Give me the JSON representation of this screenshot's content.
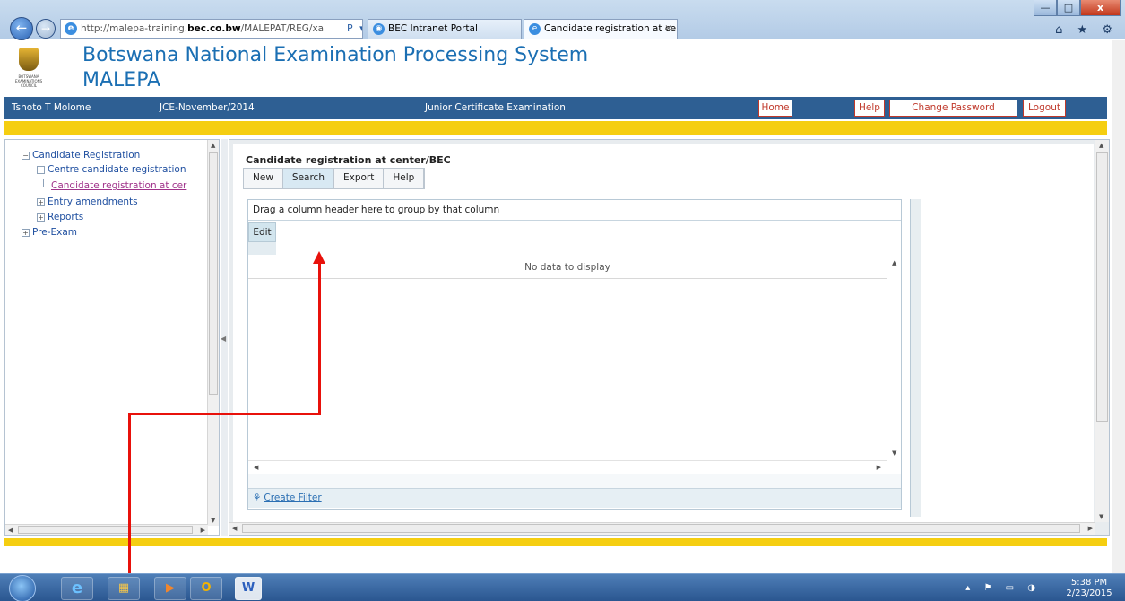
{
  "browser": {
    "url_prefix": "http://malepa-training.",
    "url_host": "bec.co.bw",
    "url_path": "/MALEPAT/REG/xa",
    "address_tools": "Ρ ▾ ☷ C ✕",
    "tabs": [
      {
        "label": "BEC Intranet Portal"
      },
      {
        "label": "Candidate registration at ce...",
        "close": "✕"
      }
    ],
    "window_controls": {
      "minimize": "—",
      "maximize": "□",
      "close": "x"
    },
    "toolbar_icons": "⌂ ★ ⚙"
  },
  "header": {
    "logo_text": "BOTSWANA EXAMINATIONS COUNCIL",
    "title": "Botswana National Examination Processing System",
    "subtitle": "MALEPA"
  },
  "navbar": {
    "user": "Tshoto T Molome",
    "session": "JCE-November/2014",
    "exam": "Junior Certificate Examination",
    "links": {
      "home": "Home",
      "help": "Help",
      "change_password": "Change Password",
      "logout": "Logout"
    }
  },
  "tree": {
    "candidate_registration": "Candidate Registration",
    "centre_candidate_registration": "Centre candidate registration",
    "candidate_registration_at_center": "Candidate registration at cer",
    "entry_amendments": "Entry amendments",
    "reports": "Reports",
    "pre_exam": "Pre-Exam",
    "expand_sign": "+",
    "collapse_sign": "−"
  },
  "main": {
    "title": "Candidate registration at center/BEC",
    "toolbar": {
      "new": "New",
      "search": "Search",
      "export": "Export",
      "help": "Help"
    },
    "grid": {
      "group_panel_text": "Drag a column header here to group by that column",
      "columns": [
        "Edit"
      ],
      "empty_text": "No data to display",
      "filter_link": "Create Filter"
    }
  },
  "taskbar": {
    "apps": [
      "internet-explorer",
      "windows-explorer",
      "media-player",
      "outlook",
      "word"
    ],
    "tray_icons": "▴ ⚑ ▭ ◑",
    "time": "5:38 PM",
    "date": "2/23/2015"
  },
  "colors": {
    "nav_bar": "#2e5f93",
    "accent_yellow": "#f5ce11",
    "title_blue": "#1b6fb3",
    "nav_link_red": "#c0392b",
    "annotation_red": "#e8110b"
  }
}
